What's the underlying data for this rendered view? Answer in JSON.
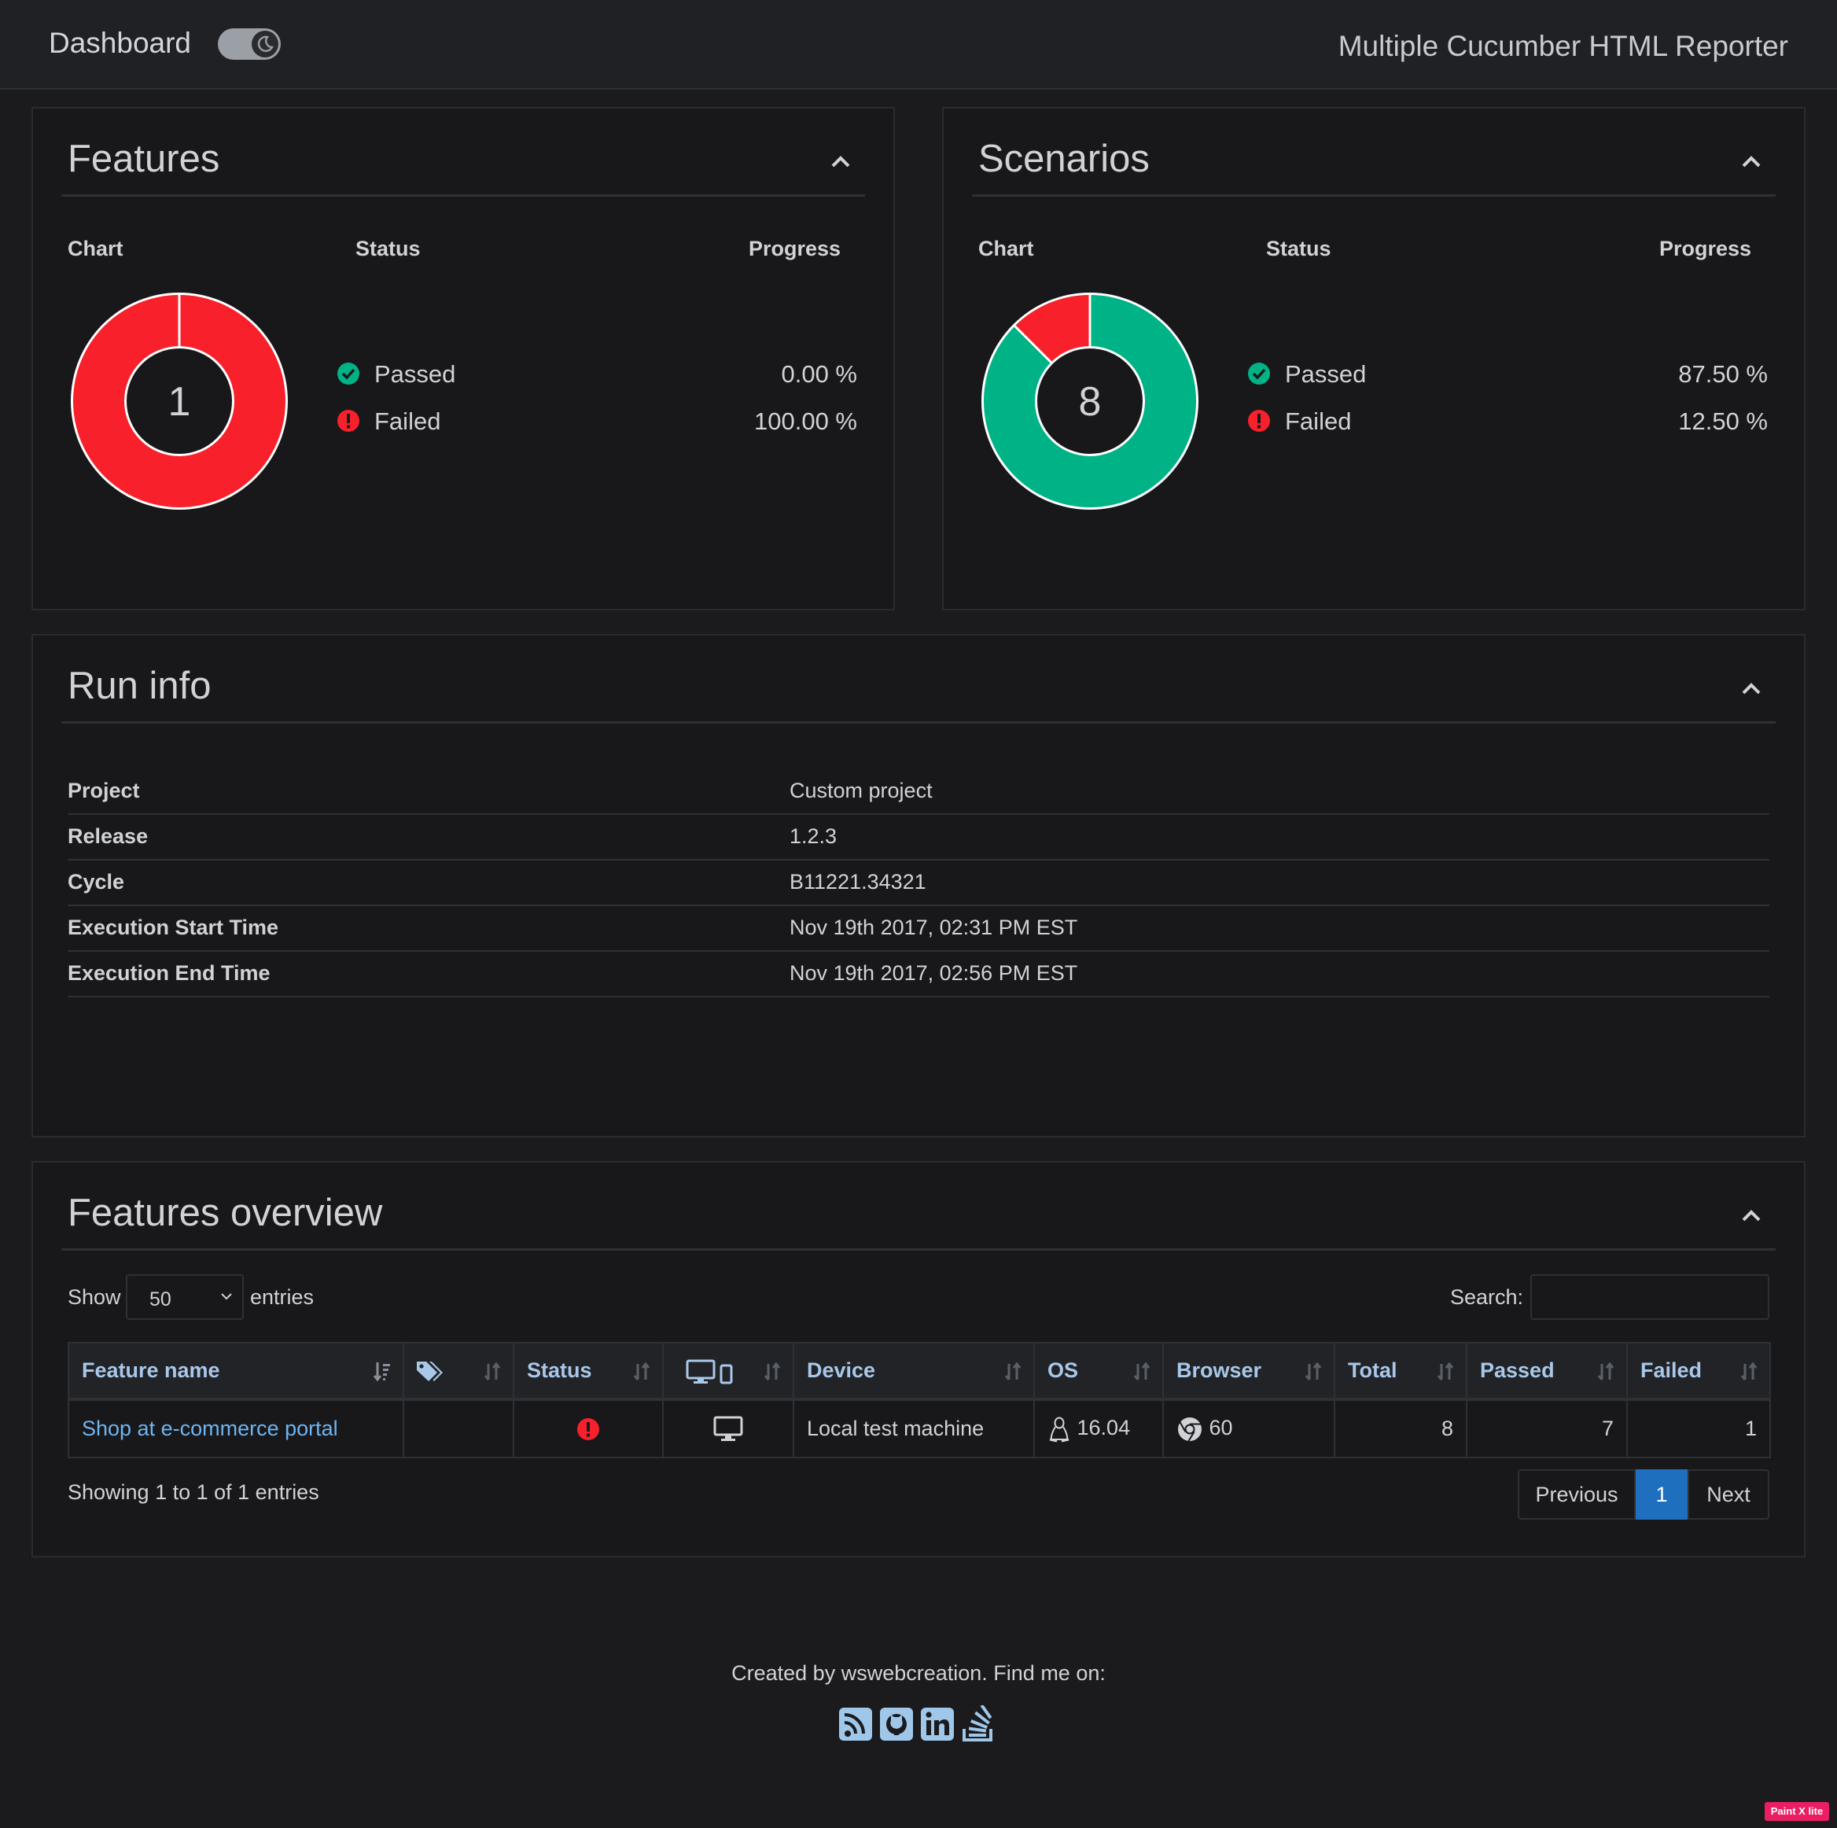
{
  "navbar": {
    "brand": "Dashboard",
    "title": "Multiple Cucumber HTML Reporter",
    "dark_mode": true
  },
  "features_panel": {
    "title": "Features",
    "col_chart": "Chart",
    "col_status": "Status",
    "col_progress": "Progress",
    "total": "1",
    "passed_label": "Passed",
    "failed_label": "Failed",
    "passed_pct": "0.00 %",
    "failed_pct": "100.00 %"
  },
  "scenarios_panel": {
    "title": "Scenarios",
    "col_chart": "Chart",
    "col_status": "Status",
    "col_progress": "Progress",
    "total": "8",
    "passed_label": "Passed",
    "failed_label": "Failed",
    "passed_pct": "87.50 %",
    "failed_pct": "12.50 %"
  },
  "run_info": {
    "title": "Run info",
    "rows": [
      {
        "key": "Project",
        "value": "Custom project"
      },
      {
        "key": "Release",
        "value": "1.2.3"
      },
      {
        "key": "Cycle",
        "value": "B11221.34321"
      },
      {
        "key": "Execution Start Time",
        "value": "Nov 19th 2017, 02:31 PM EST"
      },
      {
        "key": "Execution End Time",
        "value": "Nov 19th 2017, 02:56 PM EST"
      }
    ]
  },
  "features_overview": {
    "title": "Features overview",
    "show_label": "Show",
    "entries_label": "entries",
    "page_size": "50",
    "search_label": "Search:",
    "search_value": "",
    "columns": {
      "feature_name": "Feature name",
      "status": "Status",
      "device": "Device",
      "os": "OS",
      "browser": "Browser",
      "total": "Total",
      "passed": "Passed",
      "failed": "Failed"
    },
    "rows": [
      {
        "feature_name": "Shop at e-commerce portal",
        "status": "failed",
        "device_type": "desktop",
        "device": "Local test machine",
        "os_icon": "linux-icon",
        "os_version": "16.04",
        "browser_icon": "chrome-icon",
        "browser_version": "60",
        "total": "8",
        "passed": "7",
        "failed": "1"
      }
    ],
    "info": "Showing 1 to 1 of 1 entries",
    "pagination": {
      "previous": "Previous",
      "current": "1",
      "next": "Next"
    }
  },
  "footer": {
    "text": "Created by wswebcreation. Find me on:",
    "links": [
      "rss-icon",
      "github-icon",
      "linkedin-icon",
      "stackoverflow-icon"
    ]
  },
  "watermark": "Paint X lite",
  "colors": {
    "passed": "#00b386",
    "failed": "#f8202a",
    "accent": "#1f6fbf",
    "link": "#6fb4ef"
  }
}
